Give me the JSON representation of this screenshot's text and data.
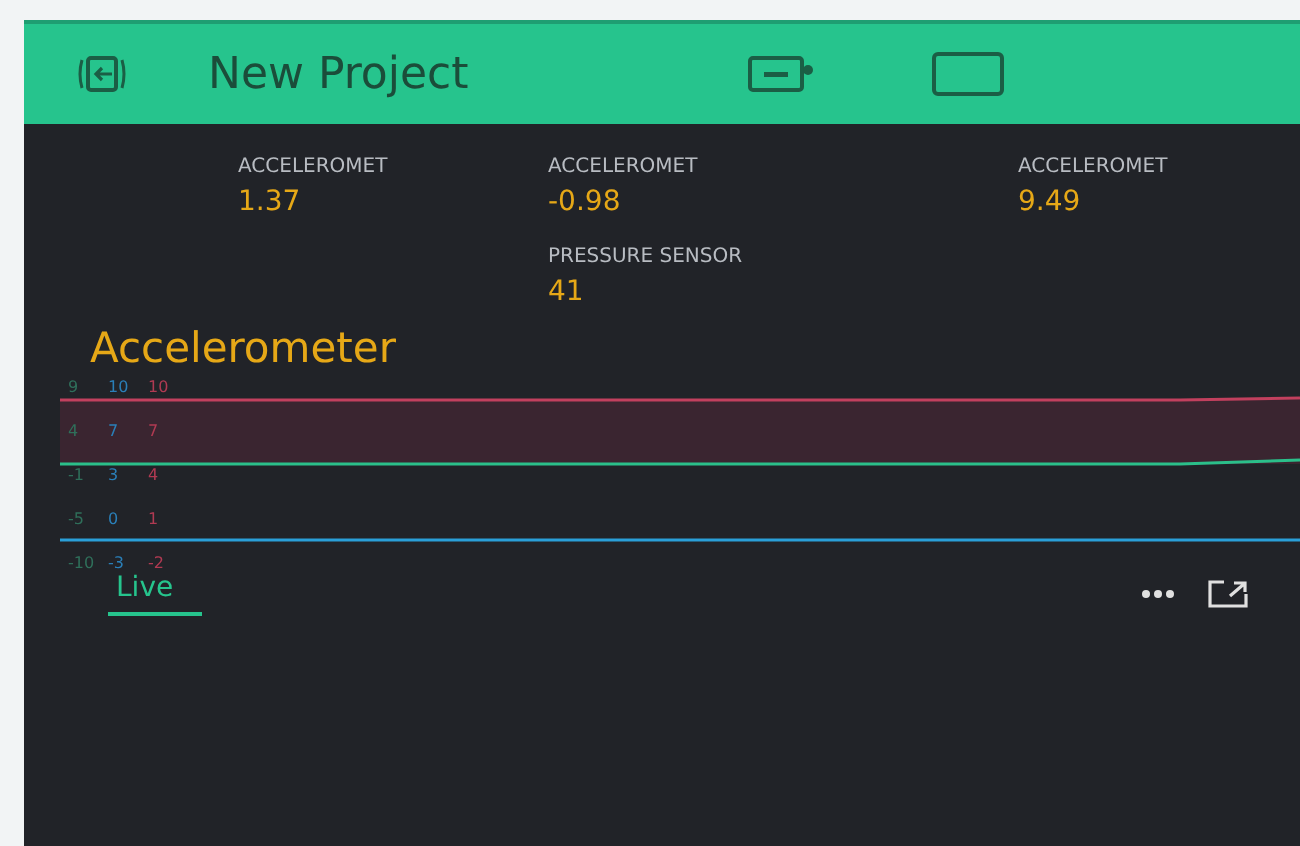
{
  "header": {
    "title": "New Project"
  },
  "values": [
    {
      "label": "ACCELEROMET",
      "value": "1.37"
    },
    {
      "label": "ACCELEROMET",
      "value": "-0.98"
    },
    {
      "label": "ACCELEROMET",
      "value": "9.49"
    },
    {
      "label": "PRESSURE SENSOR",
      "value": "41"
    }
  ],
  "chart": {
    "title": "Accelerometer",
    "axes": [
      {
        "color": "#2f6f5a",
        "ticks": [
          "9",
          "4",
          "-1",
          "-5",
          "-10"
        ]
      },
      {
        "color": "#2a7fb8",
        "ticks": [
          "10",
          "7",
          "3",
          "0",
          "-3"
        ]
      },
      {
        "color": "#b03a52",
        "ticks": [
          "10",
          "7",
          "4",
          "1",
          "-2"
        ]
      }
    ],
    "tabs": [
      {
        "label": "Live",
        "selected": true
      }
    ]
  }
}
